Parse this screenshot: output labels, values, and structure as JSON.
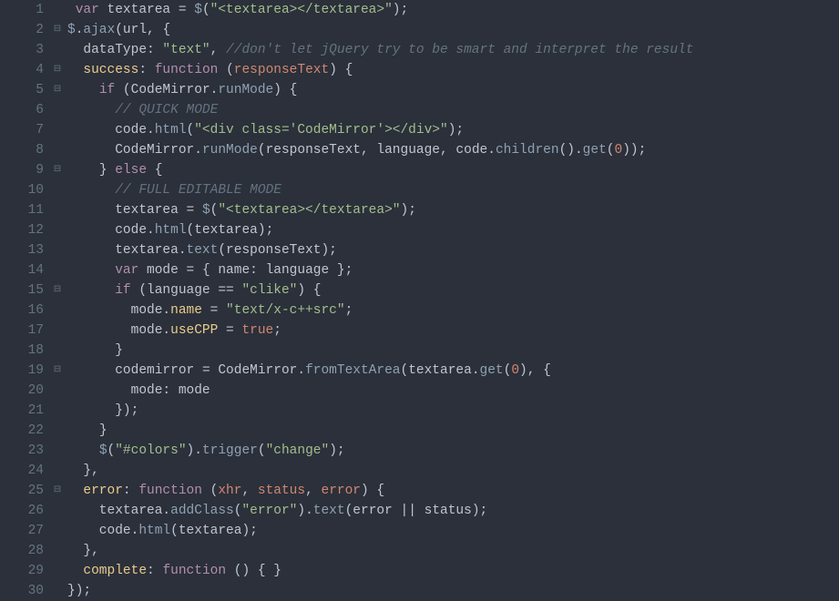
{
  "lines": [
    {
      "n": "1",
      "fold": "",
      "tokens": [
        [
          " ",
          "punc"
        ],
        [
          "var",
          "kw"
        ],
        [
          " textarea ",
          "var"
        ],
        [
          "=",
          "op"
        ],
        [
          " ",
          "punc"
        ],
        [
          "$",
          "dollar"
        ],
        [
          "(",
          "punc"
        ],
        [
          "\"<textarea></textarea>\"",
          "str"
        ],
        [
          ")",
          "punc"
        ],
        [
          ";",
          "punc"
        ]
      ]
    },
    {
      "n": "2",
      "fold": "⊟",
      "tokens": [
        [
          "$",
          "dollar"
        ],
        [
          ".",
          "punc"
        ],
        [
          "ajax",
          "fn"
        ],
        [
          "(",
          "punc"
        ],
        [
          "url",
          "var"
        ],
        [
          ",",
          "punc"
        ],
        [
          " ",
          "punc"
        ],
        [
          "{",
          "punc"
        ]
      ]
    },
    {
      "n": "3",
      "fold": "",
      "tokens": [
        [
          "  dataType",
          "var"
        ],
        [
          ":",
          "punc"
        ],
        [
          " ",
          "punc"
        ],
        [
          "\"text\"",
          "str"
        ],
        [
          ",",
          "punc"
        ],
        [
          " ",
          "punc"
        ],
        [
          "//don't let jQuery try to be smart and interpret the result",
          "cmt"
        ]
      ]
    },
    {
      "n": "4",
      "fold": "⊟",
      "tokens": [
        [
          "  ",
          "punc"
        ],
        [
          "success",
          "prop"
        ],
        [
          ":",
          "punc"
        ],
        [
          " ",
          "punc"
        ],
        [
          "function",
          "kw"
        ],
        [
          " ",
          "punc"
        ],
        [
          "(",
          "punc"
        ],
        [
          "responseText",
          "param"
        ],
        [
          ")",
          "punc"
        ],
        [
          " ",
          "punc"
        ],
        [
          "{",
          "punc"
        ]
      ]
    },
    {
      "n": "5",
      "fold": "⊟",
      "tokens": [
        [
          "    ",
          "punc"
        ],
        [
          "if",
          "kw"
        ],
        [
          " ",
          "punc"
        ],
        [
          "(",
          "punc"
        ],
        [
          "CodeMirror",
          "var"
        ],
        [
          ".",
          "punc"
        ],
        [
          "runMode",
          "fn"
        ],
        [
          ")",
          "punc"
        ],
        [
          " ",
          "punc"
        ],
        [
          "{",
          "punc"
        ]
      ]
    },
    {
      "n": "6",
      "fold": "",
      "tokens": [
        [
          "      ",
          "punc"
        ],
        [
          "// QUICK MODE",
          "cmt"
        ]
      ]
    },
    {
      "n": "7",
      "fold": "",
      "tokens": [
        [
          "      code",
          "var"
        ],
        [
          ".",
          "punc"
        ],
        [
          "html",
          "fn"
        ],
        [
          "(",
          "punc"
        ],
        [
          "\"<div class='CodeMirror'></div>\"",
          "str"
        ],
        [
          ")",
          "punc"
        ],
        [
          ";",
          "punc"
        ]
      ]
    },
    {
      "n": "8",
      "fold": "",
      "tokens": [
        [
          "      CodeMirror",
          "var"
        ],
        [
          ".",
          "punc"
        ],
        [
          "runMode",
          "fn"
        ],
        [
          "(",
          "punc"
        ],
        [
          "responseText",
          "var"
        ],
        [
          ",",
          "punc"
        ],
        [
          " language",
          "var"
        ],
        [
          ",",
          "punc"
        ],
        [
          " code",
          "var"
        ],
        [
          ".",
          "punc"
        ],
        [
          "children",
          "fn"
        ],
        [
          "(",
          "punc"
        ],
        [
          ")",
          "punc"
        ],
        [
          ".",
          "punc"
        ],
        [
          "get",
          "fn"
        ],
        [
          "(",
          "punc"
        ],
        [
          "0",
          "num"
        ],
        [
          ")",
          "punc"
        ],
        [
          ")",
          "punc"
        ],
        [
          ";",
          "punc"
        ]
      ]
    },
    {
      "n": "9",
      "fold": "⊟",
      "tokens": [
        [
          "    ",
          "punc"
        ],
        [
          "}",
          "punc"
        ],
        [
          " ",
          "punc"
        ],
        [
          "else",
          "kw"
        ],
        [
          " ",
          "punc"
        ],
        [
          "{",
          "punc"
        ]
      ]
    },
    {
      "n": "10",
      "fold": "",
      "tokens": [
        [
          "      ",
          "punc"
        ],
        [
          "// FULL EDITABLE MODE",
          "cmt"
        ]
      ]
    },
    {
      "n": "11",
      "fold": "",
      "tokens": [
        [
          "      textarea ",
          "var"
        ],
        [
          "=",
          "op"
        ],
        [
          " ",
          "punc"
        ],
        [
          "$",
          "dollar"
        ],
        [
          "(",
          "punc"
        ],
        [
          "\"<textarea></textarea>\"",
          "str"
        ],
        [
          ")",
          "punc"
        ],
        [
          ";",
          "punc"
        ]
      ]
    },
    {
      "n": "12",
      "fold": "",
      "tokens": [
        [
          "      code",
          "var"
        ],
        [
          ".",
          "punc"
        ],
        [
          "html",
          "fn"
        ],
        [
          "(",
          "punc"
        ],
        [
          "textarea",
          "var"
        ],
        [
          ")",
          "punc"
        ],
        [
          ";",
          "punc"
        ]
      ]
    },
    {
      "n": "13",
      "fold": "",
      "tokens": [
        [
          "      textarea",
          "var"
        ],
        [
          ".",
          "punc"
        ],
        [
          "text",
          "fn"
        ],
        [
          "(",
          "punc"
        ],
        [
          "responseText",
          "var"
        ],
        [
          ")",
          "punc"
        ],
        [
          ";",
          "punc"
        ]
      ]
    },
    {
      "n": "14",
      "fold": "",
      "tokens": [
        [
          "      ",
          "punc"
        ],
        [
          "var",
          "kw"
        ],
        [
          " mode ",
          "var"
        ],
        [
          "=",
          "op"
        ],
        [
          " ",
          "punc"
        ],
        [
          "{",
          "punc"
        ],
        [
          " name",
          "var"
        ],
        [
          ":",
          "punc"
        ],
        [
          " language ",
          "var"
        ],
        [
          "}",
          "punc"
        ],
        [
          ";",
          "punc"
        ]
      ]
    },
    {
      "n": "15",
      "fold": "⊟",
      "tokens": [
        [
          "      ",
          "punc"
        ],
        [
          "if",
          "kw"
        ],
        [
          " ",
          "punc"
        ],
        [
          "(",
          "punc"
        ],
        [
          "language ",
          "var"
        ],
        [
          "==",
          "op"
        ],
        [
          " ",
          "punc"
        ],
        [
          "\"clike\"",
          "str"
        ],
        [
          ")",
          "punc"
        ],
        [
          " ",
          "punc"
        ],
        [
          "{",
          "punc"
        ]
      ]
    },
    {
      "n": "16",
      "fold": "",
      "tokens": [
        [
          "        mode",
          "var"
        ],
        [
          ".",
          "punc"
        ],
        [
          "name",
          "prop"
        ],
        [
          " ",
          "punc"
        ],
        [
          "=",
          "op"
        ],
        [
          " ",
          "punc"
        ],
        [
          "\"text/x-c++src\"",
          "str"
        ],
        [
          ";",
          "punc"
        ]
      ]
    },
    {
      "n": "17",
      "fold": "",
      "tokens": [
        [
          "        mode",
          "var"
        ],
        [
          ".",
          "punc"
        ],
        [
          "useCPP",
          "prop"
        ],
        [
          " ",
          "punc"
        ],
        [
          "=",
          "op"
        ],
        [
          " ",
          "punc"
        ],
        [
          "true",
          "bool"
        ],
        [
          ";",
          "punc"
        ]
      ]
    },
    {
      "n": "18",
      "fold": "",
      "tokens": [
        [
          "      ",
          "punc"
        ],
        [
          "}",
          "punc"
        ]
      ]
    },
    {
      "n": "19",
      "fold": "⊟",
      "tokens": [
        [
          "      codemirror ",
          "var"
        ],
        [
          "=",
          "op"
        ],
        [
          " CodeMirror",
          "var"
        ],
        [
          ".",
          "punc"
        ],
        [
          "fromTextArea",
          "fn"
        ],
        [
          "(",
          "punc"
        ],
        [
          "textarea",
          "var"
        ],
        [
          ".",
          "punc"
        ],
        [
          "get",
          "fn"
        ],
        [
          "(",
          "punc"
        ],
        [
          "0",
          "num"
        ],
        [
          ")",
          "punc"
        ],
        [
          ",",
          "punc"
        ],
        [
          " ",
          "punc"
        ],
        [
          "{",
          "punc"
        ]
      ]
    },
    {
      "n": "20",
      "fold": "",
      "tokens": [
        [
          "        mode",
          "var"
        ],
        [
          ":",
          "punc"
        ],
        [
          " mode",
          "var"
        ]
      ]
    },
    {
      "n": "21",
      "fold": "",
      "tokens": [
        [
          "      ",
          "punc"
        ],
        [
          "}",
          "punc"
        ],
        [
          ")",
          "punc"
        ],
        [
          ";",
          "punc"
        ]
      ]
    },
    {
      "n": "22",
      "fold": "",
      "tokens": [
        [
          "    ",
          "punc"
        ],
        [
          "}",
          "punc"
        ]
      ]
    },
    {
      "n": "23",
      "fold": "",
      "tokens": [
        [
          "    ",
          "punc"
        ],
        [
          "$",
          "dollar"
        ],
        [
          "(",
          "punc"
        ],
        [
          "\"#colors\"",
          "str"
        ],
        [
          ")",
          "punc"
        ],
        [
          ".",
          "punc"
        ],
        [
          "trigger",
          "fn"
        ],
        [
          "(",
          "punc"
        ],
        [
          "\"change\"",
          "str"
        ],
        [
          ")",
          "punc"
        ],
        [
          ";",
          "punc"
        ]
      ]
    },
    {
      "n": "24",
      "fold": "",
      "tokens": [
        [
          "  ",
          "punc"
        ],
        [
          "}",
          "punc"
        ],
        [
          ",",
          "punc"
        ]
      ]
    },
    {
      "n": "25",
      "fold": "⊟",
      "tokens": [
        [
          "  ",
          "punc"
        ],
        [
          "error",
          "prop"
        ],
        [
          ":",
          "punc"
        ],
        [
          " ",
          "punc"
        ],
        [
          "function",
          "kw"
        ],
        [
          " ",
          "punc"
        ],
        [
          "(",
          "punc"
        ],
        [
          "xhr",
          "param"
        ],
        [
          ",",
          "punc"
        ],
        [
          " ",
          "punc"
        ],
        [
          "status",
          "param"
        ],
        [
          ",",
          "punc"
        ],
        [
          " ",
          "punc"
        ],
        [
          "error",
          "param"
        ],
        [
          ")",
          "punc"
        ],
        [
          " ",
          "punc"
        ],
        [
          "{",
          "punc"
        ]
      ]
    },
    {
      "n": "26",
      "fold": "",
      "tokens": [
        [
          "    textarea",
          "var"
        ],
        [
          ".",
          "punc"
        ],
        [
          "addClass",
          "fn"
        ],
        [
          "(",
          "punc"
        ],
        [
          "\"error\"",
          "str"
        ],
        [
          ")",
          "punc"
        ],
        [
          ".",
          "punc"
        ],
        [
          "text",
          "fn"
        ],
        [
          "(",
          "punc"
        ],
        [
          "error ",
          "var"
        ],
        [
          "||",
          "op"
        ],
        [
          " status",
          "var"
        ],
        [
          ")",
          "punc"
        ],
        [
          ";",
          "punc"
        ]
      ]
    },
    {
      "n": "27",
      "fold": "",
      "tokens": [
        [
          "    code",
          "var"
        ],
        [
          ".",
          "punc"
        ],
        [
          "html",
          "fn"
        ],
        [
          "(",
          "punc"
        ],
        [
          "textarea",
          "var"
        ],
        [
          ")",
          "punc"
        ],
        [
          ";",
          "punc"
        ]
      ]
    },
    {
      "n": "28",
      "fold": "",
      "tokens": [
        [
          "  ",
          "punc"
        ],
        [
          "}",
          "punc"
        ],
        [
          ",",
          "punc"
        ]
      ]
    },
    {
      "n": "29",
      "fold": "",
      "tokens": [
        [
          "  ",
          "punc"
        ],
        [
          "complete",
          "prop"
        ],
        [
          ":",
          "punc"
        ],
        [
          " ",
          "punc"
        ],
        [
          "function",
          "kw"
        ],
        [
          " ",
          "punc"
        ],
        [
          "(",
          "punc"
        ],
        [
          ")",
          "punc"
        ],
        [
          " ",
          "punc"
        ],
        [
          "{",
          "punc"
        ],
        [
          " ",
          "punc"
        ],
        [
          "}",
          "punc"
        ]
      ]
    },
    {
      "n": "30",
      "fold": "",
      "tokens": [
        [
          "}",
          "punc"
        ],
        [
          ")",
          "punc"
        ],
        [
          ";",
          "punc"
        ]
      ]
    }
  ]
}
